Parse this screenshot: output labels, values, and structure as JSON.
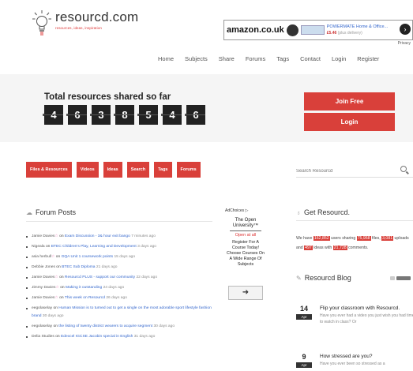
{
  "site": {
    "name": "resourcd.com",
    "tagline": "resources, ideas, inspiration"
  },
  "ad_banner": {
    "brand": "amazon.co.uk",
    "product_title": "POWERMATE Home & Office...",
    "price": "£5.46",
    "price_note": "(plus delivery)",
    "prev": "Privacy"
  },
  "nav": [
    {
      "label": "Home"
    },
    {
      "label": "Subjects"
    },
    {
      "label": "Share"
    },
    {
      "label": "Forums"
    },
    {
      "label": "Tags"
    },
    {
      "label": "Contact"
    },
    {
      "label": "Login"
    },
    {
      "label": "Register"
    }
  ],
  "counter": {
    "title": "Total resources shared so far",
    "digits": [
      "4",
      "6",
      "3",
      "8",
      "5",
      "4",
      "6"
    ]
  },
  "auth": {
    "join": "Join Free",
    "login": "Login"
  },
  "categories": [
    {
      "label": "Files & Resources"
    },
    {
      "label": "Videos"
    },
    {
      "label": "Ideas"
    },
    {
      "label": "Search"
    },
    {
      "label": "Tags"
    },
    {
      "label": "Forums"
    }
  ],
  "search": {
    "placeholder": "Search Resourcd"
  },
  "forum": {
    "title": "Forum Posts",
    "posts": [
      {
        "user": "Jamie Davies",
        "star": true,
        "on": "on",
        "topic": "Exam Discussion - 3& hour exit bango",
        "date": "7 minutes ago"
      },
      {
        "user": "Nigeala",
        "star": false,
        "on": "on",
        "topic": "BTEC Children's Play, Learning and Development",
        "date": "3 days ago"
      },
      {
        "user": "asia herbull",
        "star": true,
        "on": "on",
        "topic": "GQA Unit 1 coursework points",
        "date": "15 days ago"
      },
      {
        "user": "Debbie Jones",
        "star": false,
        "on": "on",
        "topic": "BTEC Sub Diploma",
        "date": "21 days ago"
      },
      {
        "user": "Jamie Davies",
        "star": true,
        "on": "on",
        "topic": "Resourcd PLUS - support our community",
        "date": "22 days ago"
      },
      {
        "user": "Jimmy Davies",
        "star": true,
        "on": "on",
        "topic": "Making it outstanding",
        "date": "24 days ago"
      },
      {
        "user": "Jamie Davies",
        "star": true,
        "on": "on",
        "topic": "This week on Resourcd",
        "date": "26 days ago"
      },
      {
        "user": "eegolaselay",
        "star": false,
        "on": "on",
        "topic": "Human Mission is to turned out to get a single on the most adorable sport lifestyle fashion brand",
        "date": "30 days ago"
      },
      {
        "user": "eegolaselay",
        "star": false,
        "on": "on",
        "topic": "the listing of twenty district wearers to acquire segment",
        "date": "30 days ago"
      },
      {
        "user": "Delia Studies",
        "star": false,
        "on": "on",
        "topic": "Edexcel IGCSE Jacobin special in English",
        "date": "31 days ago"
      }
    ]
  },
  "side_ad": {
    "label": "AdChoices ▷",
    "logo_line1": "The Open",
    "logo_line2": "University™",
    "open": "Open at all",
    "copy": "Register For A Course Today! Choose Courses On A Wide Range Of Subjects",
    "arrow": "➜"
  },
  "get_resourcd": {
    "title": "Get Resourcd.",
    "t1": "We have",
    "users": "162,852",
    "t2": "users sharing",
    "files": "75,958",
    "t3": "files,",
    "links": "3,081",
    "t4": "uploads and",
    "ideas": "497",
    "t5": "ideas with",
    "comments": "21,728",
    "t6": "comments."
  },
  "blog": {
    "title": "Resourcd Blog",
    "items": [
      {
        "day": "14",
        "month": "Apr",
        "head": "Flip your classroom with Resourcd.",
        "sub": "Have you ever had a video you just wish you had time to watch in class? Or"
      },
      {
        "day": "9",
        "month": "Apr",
        "head": "How stressed are you?",
        "sub": "Have you ever been so stressed as a"
      }
    ]
  },
  "colors": {
    "accent": "#d9403a",
    "link": "#3366cc",
    "dark_digit": "#222222"
  }
}
